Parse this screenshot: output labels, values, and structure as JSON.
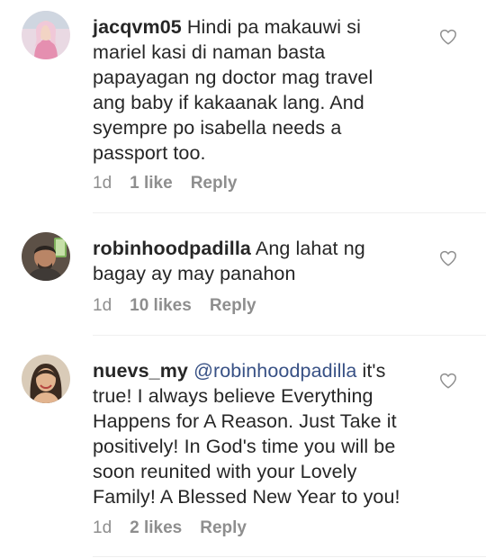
{
  "comments": [
    {
      "username": "jacqvm05",
      "mention": "",
      "lines": [
        "Hindi pa makauwi si",
        "mariel kasi di naman basta",
        "papayagan ng doctor mag travel",
        "ang baby if kakaanak lang. And",
        "syempre po isabella needs a",
        "passport too."
      ],
      "time": "1d",
      "likes": "1 like",
      "reply": "Reply",
      "avatar_icon": "user-avatar-woman-pink-icon"
    },
    {
      "username": "robinhoodpadilla",
      "mention": "",
      "lines": [
        "Ang lahat ng",
        "bagay ay may panahon"
      ],
      "time": "1d",
      "likes": "10 likes",
      "reply": "Reply",
      "avatar_icon": "user-avatar-man-icon"
    },
    {
      "username": "nuevs_my",
      "mention": "@robinhoodpadilla",
      "lines": [
        "it's",
        "true! I always believe Everything",
        "Happens for A Reason. Just Take it",
        "positively! In God's time you will be",
        "soon reunited with your Lovely",
        "Family! A Blessed New Year to you!"
      ],
      "time": "1d",
      "likes": "2 likes",
      "reply": "Reply",
      "avatar_icon": "user-avatar-woman-icon"
    }
  ],
  "colors": {
    "text": "#262626",
    "meta": "#8e8e8e",
    "mention": "#385185",
    "divider": "#efefef"
  }
}
